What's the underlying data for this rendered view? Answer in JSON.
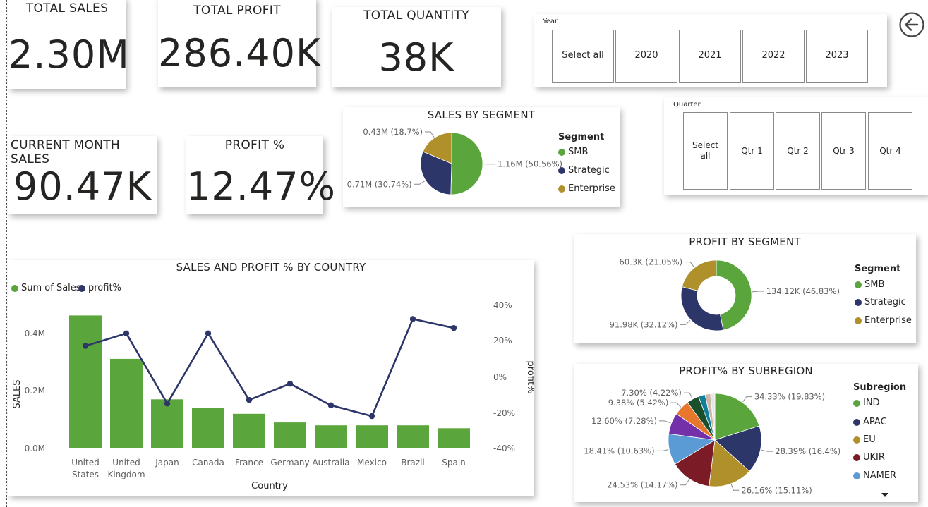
{
  "kpis": {
    "total_sales": {
      "title": "TOTAL SALES",
      "value": "2.30M"
    },
    "total_profit": {
      "title": "TOTAL PROFIT",
      "value": "286.40K"
    },
    "total_quantity": {
      "title": "TOTAL QUANTITY",
      "value": "38K"
    },
    "current_month_sales": {
      "title": "CURRENT MONTH SALES",
      "value": "90.47K"
    },
    "profit_pct": {
      "title": "PROFIT %",
      "value": "12.47%"
    }
  },
  "year_slicer": {
    "title": "Year",
    "options": [
      "Select all",
      "2020",
      "2021",
      "2022",
      "2023"
    ]
  },
  "quarter_slicer": {
    "title": "Quarter",
    "options": [
      "Select all",
      "Qtr 1",
      "Qtr 2",
      "Qtr 3",
      "Qtr 4"
    ]
  },
  "back_button": {
    "icon": "arrow-left-circle-icon"
  },
  "sales_by_segment": {
    "title": "SALES BY SEGMENT",
    "legend_title": "Segment",
    "labels": [
      "1.16M (50.56%)",
      "0.71M (30.74%)",
      "0.43M (18.7%)"
    ]
  },
  "profit_by_segment": {
    "title": "PROFIT BY SEGMENT",
    "legend_title": "Segment",
    "labels": [
      "134.12K (46.83%)",
      "91.98K (32.12%)",
      "60.3K (21.05%)"
    ]
  },
  "profit_by_subregion": {
    "title": "PROFIT% BY SUBREGION",
    "legend_title": "Subregion",
    "legend_more_icon": "caret-down-icon",
    "labels": [
      "34.33% (19.83%)",
      "28.39% (16.4%)",
      "26.16% (15.11%)",
      "24.53% (14.17%)",
      "18.41% (10.63%)",
      "12.60% (7.28%)",
      "9.38% (5.42%)",
      "7.30% (4.22%)"
    ]
  },
  "sales_profit_country": {
    "title": "SALES AND PROFIT % BY COUNTRY",
    "legend": [
      "Sum of Sales",
      "profit%"
    ],
    "xlabel": "Country",
    "ylabel": "SALES",
    "y2label": "profit%",
    "y_ticks": [
      "0.4M",
      "0.2M",
      "0.0M"
    ],
    "y2_ticks": [
      "40%",
      "20%",
      "0%",
      "-20%",
      "-40%"
    ]
  },
  "chart_data": [
    {
      "type": "pie",
      "title": "SALES BY SEGMENT",
      "legend_title": "Segment",
      "categories": [
        "SMB",
        "Strategic",
        "Enterprise"
      ],
      "values": [
        1.16,
        0.71,
        0.43
      ],
      "percents": [
        50.56,
        30.74,
        18.7
      ],
      "colors": [
        "#5aa63c",
        "#2c3669",
        "#b0902a"
      ],
      "legend_position": "right"
    },
    {
      "type": "pie",
      "donut": true,
      "title": "PROFIT BY SEGMENT",
      "legend_title": "Segment",
      "categories": [
        "SMB",
        "Strategic",
        "Enterprise"
      ],
      "values": [
        134.12,
        91.98,
        60.3
      ],
      "percents": [
        46.83,
        32.12,
        21.05
      ],
      "colors": [
        "#5aa63c",
        "#2c3669",
        "#b0902a"
      ],
      "legend_position": "right"
    },
    {
      "type": "pie",
      "title": "PROFIT% BY SUBREGION",
      "legend_title": "Subregion",
      "categories": [
        "IND",
        "APAC",
        "EU",
        "UKIR",
        "NAMER"
      ],
      "values": [
        34.33,
        28.39,
        26.16,
        24.53,
        18.41,
        12.6,
        9.38,
        7.3,
        4.0,
        3.2,
        2.6
      ],
      "percents": [
        19.83,
        16.4,
        15.11,
        14.17,
        10.63,
        7.28,
        5.42,
        4.22
      ],
      "colors": [
        "#5aa63c",
        "#2c3669",
        "#b0902a",
        "#7a1b25",
        "#5b9bd5",
        "#7430a8",
        "#e8772e",
        "#1b4f2c",
        "#137e9a",
        "#cbb8a8",
        "#e6e6e6"
      ],
      "legend_position": "right"
    },
    {
      "type": "bar",
      "title": "SALES AND PROFIT % BY COUNTRY",
      "categories": [
        "United States",
        "United Kingdom",
        "Japan",
        "Canada",
        "France",
        "Germany",
        "Australia",
        "Mexico",
        "Brazil",
        "Spain"
      ],
      "series": [
        {
          "name": "Sum of Sales",
          "type": "bar",
          "axis": "left",
          "values": [
            0.46,
            0.31,
            0.17,
            0.14,
            0.12,
            0.09,
            0.08,
            0.08,
            0.08,
            0.07
          ],
          "color": "#5aa63c"
        },
        {
          "name": "profit%",
          "type": "line",
          "axis": "right",
          "values": [
            17,
            24,
            -15,
            24,
            -13,
            -4,
            -16,
            -22,
            32,
            27
          ],
          "color": "#2c3669"
        }
      ],
      "xlabel": "Country",
      "ylabel": "SALES",
      "y2label": "profit%",
      "ylim": [
        0,
        0.5
      ],
      "y2lim": [
        -40,
        40
      ],
      "legend_position": "top-left"
    }
  ]
}
